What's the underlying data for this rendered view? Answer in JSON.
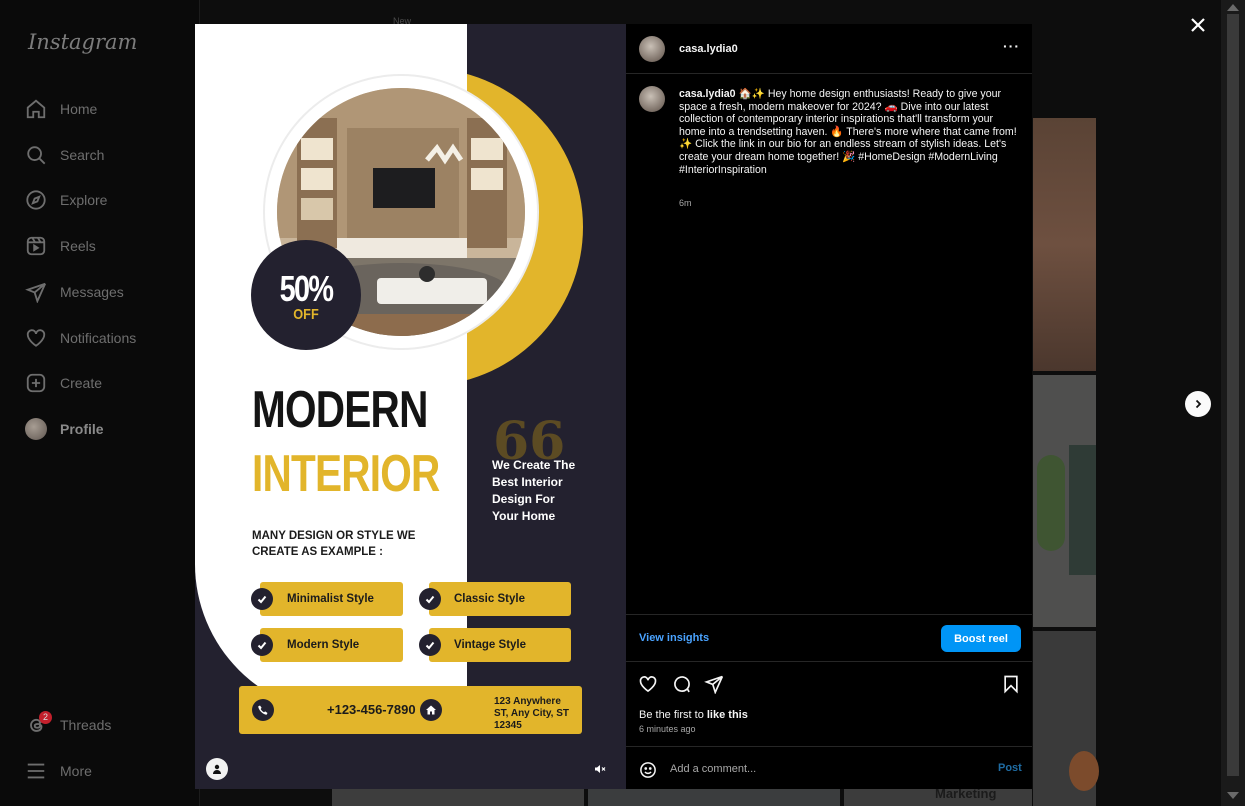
{
  "sidebar": {
    "logo": "Instagram",
    "items": [
      {
        "label": "Home",
        "icon": "home-icon"
      },
      {
        "label": "Search",
        "icon": "search-icon"
      },
      {
        "label": "Explore",
        "icon": "compass-icon"
      },
      {
        "label": "Reels",
        "icon": "reels-icon"
      },
      {
        "label": "Messages",
        "icon": "send-icon"
      },
      {
        "label": "Notifications",
        "icon": "heart-icon"
      },
      {
        "label": "Create",
        "icon": "plus-square-icon"
      },
      {
        "label": "Profile",
        "icon": "avatar"
      }
    ],
    "threads": {
      "label": "Threads",
      "badge": "2",
      "icon": "threads-icon"
    },
    "more": {
      "label": "More",
      "icon": "menu-icon"
    }
  },
  "background": {
    "stray_text": "New",
    "tile_text": "Marketing"
  },
  "poster": {
    "discount_value": "50%",
    "discount_word": "OFF",
    "title_line1": "MODERN",
    "title_line2": "INTERIOR",
    "subheading": "MANY DESIGN OR STYLE WE CREATE AS EXAMPLE :",
    "quote_mark": "66",
    "tagline": "We Create The Best Interior Design For Your Home",
    "styles": [
      "Minimalist Style",
      "Classic Style",
      "Modern Style",
      "Vintage Style"
    ],
    "phone": "+123-456-7890",
    "address": "123 Anywhere ST, Any City, ST 12345",
    "colors": {
      "accent": "#e2b52b",
      "dark": "#23212f"
    }
  },
  "panel": {
    "username": "casa.lydia0",
    "more_label": "···",
    "caption_user": "casa.lydia0",
    "caption_text": "🏠✨ Hey home design enthusiasts! Ready to give your space a fresh, modern makeover for 2024? 🚗 Dive into our latest collection of contemporary interior inspirations that'll transform your home into a trendsetting haven. 🔥 There's more where that came from! ✨ Click the link in our bio for an endless stream of stylish ideas. Let's create your dream home together! 🎉 #HomeDesign #ModernLiving #InteriorInspiration",
    "caption_time": "6m",
    "view_insights": "View insights",
    "boost_label": "Boost reel",
    "likes_prefix": "Be the first to ",
    "likes_link": "like this",
    "time_ago": "6 minutes ago",
    "comment_placeholder": "Add a comment...",
    "post_label": "Post"
  },
  "colors": {
    "link": "#4aa3ff",
    "button": "#0095f6"
  }
}
